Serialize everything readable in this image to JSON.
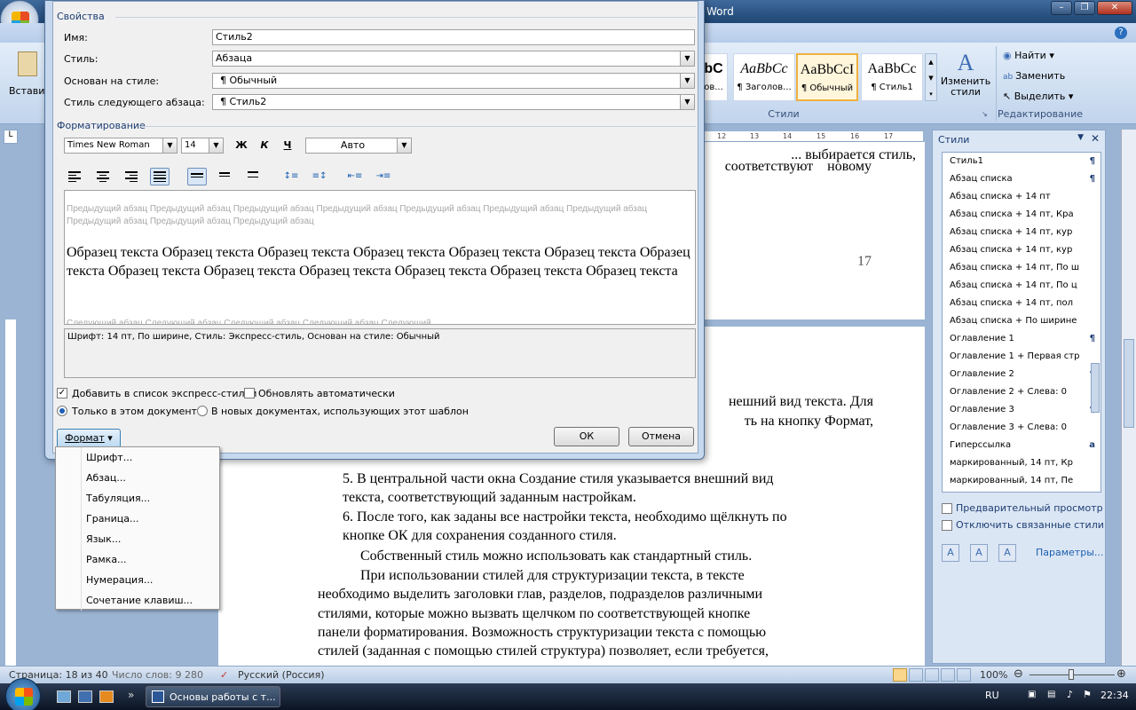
{
  "window": {
    "title": "Word"
  },
  "ribbon": {
    "paste_label": "Встави",
    "styles_group_label": "Стили",
    "editing_group_label": "Редактирование",
    "style_tiles": [
      {
        "sample": "bС",
        "name": "ов..."
      },
      {
        "sample": "AaBbCc",
        "name": "¶ Заголов..."
      },
      {
        "sample": "AaBbCcI",
        "name": "¶ Обычный"
      },
      {
        "sample": "AaBbCc",
        "name": "¶ Стиль1"
      }
    ],
    "change_styles_label": "Изменить стили",
    "find_label": "Найти",
    "replace_label": "Заменить",
    "select_label": "Выделить"
  },
  "ruler": {
    "marks": [
      "12",
      "13",
      "14",
      "15",
      "16",
      "17"
    ]
  },
  "document": {
    "page1_lines": [
      "... выбирается стиль,",
      "соответствуют новому"
    ],
    "page1_number": "17",
    "page2_lines_right": [
      "нешний вид текста. Для",
      "ть на кнопку Формат,"
    ],
    "page2_paragraphs": [
      "5. В центральной части окна Создание стиля указывается внешний вид",
      "текста, соответствующий заданным настройкам.",
      "6. После того, как заданы все настройки текста, необходимо щёлкнуть по",
      "кнопке ОК для сохранения созданного стиля.",
      "Собственный стиль можно использовать как стандартный стиль.",
      "При использовании стилей для структуризации текста, в тексте",
      "необходимо выделить заголовки глав, разделов, подразделов различными",
      "стилями, которые можно вызвать щелчком по соответствующей кнопке",
      "панели форматирования. Возможность структуризации текста с помощью",
      "стилей (заданная с помощью стилей структура) позволяет, если требуется,"
    ]
  },
  "styles_pane": {
    "title": "Стили",
    "items": [
      {
        "name": "Стиль1",
        "mark": "¶"
      },
      {
        "name": "Абзац списка",
        "mark": "¶"
      },
      {
        "name": "Абзац списка + 14 пт",
        "mark": ""
      },
      {
        "name": "Абзац списка + 14 пт, Кра",
        "mark": ""
      },
      {
        "name": "Абзац списка + 14 пт, кур",
        "mark": ""
      },
      {
        "name": "Абзац списка + 14 пт, кур",
        "mark": ""
      },
      {
        "name": "Абзац списка + 14 пт, По ш",
        "mark": ""
      },
      {
        "name": "Абзац списка + 14 пт, По ц",
        "mark": ""
      },
      {
        "name": "Абзац списка + 14 пт, пол",
        "mark": ""
      },
      {
        "name": "Абзац списка + По ширине",
        "mark": ""
      },
      {
        "name": "Оглавление 1",
        "mark": "¶"
      },
      {
        "name": "Оглавление 1 + Первая стр",
        "mark": ""
      },
      {
        "name": "Оглавление 2",
        "mark": "¶"
      },
      {
        "name": "Оглавление 2 + Слева:  0",
        "mark": ""
      },
      {
        "name": "Оглавление 3",
        "mark": "¶"
      },
      {
        "name": "Оглавление 3 + Слева:  0",
        "mark": ""
      },
      {
        "name": "Гиперссылка",
        "mark": "a"
      },
      {
        "name": "маркированный, 14 пт, Кр",
        "mark": ""
      },
      {
        "name": "маркированный, 14 пт, Пе",
        "mark": ""
      }
    ],
    "preview_label": "Предварительный просмотр",
    "disable_linked_label": "Отключить связанные стили",
    "params_label": "Параметры..."
  },
  "dialog": {
    "section_props": "Свойства",
    "name_label": "Имя:",
    "name_value": "Стиль2",
    "style_label": "Стиль:",
    "style_value": "Абзаца",
    "based_label": "Основан на стиле:",
    "based_value": "¶  Обычный",
    "next_label": "Стиль следующего абзаца:",
    "next_value": "¶  Стиль2",
    "section_format": "Форматирование",
    "font_name": "Times New Roman",
    "font_size": "14",
    "bold": "Ж",
    "italic": "К",
    "underline": "Ч",
    "color_value": "Авто",
    "preview_prev": "Предыдущий абзац Предыдущий абзац Предыдущий абзац Предыдущий абзац Предыдущий абзац Предыдущий абзац Предыдущий абзац Предыдущий абзац Предыдущий абзац Предыдущий абзац",
    "preview_sample": "Образец текста Образец текста Образец текста Образец текста Образец текста Образец текста Образец текста Образец текста Образец текста Образец текста Образец текста Образец текста Образец текста",
    "preview_next": "Следующий абзац Следующий абзац Следующий абзац Следующий абзац Следующий",
    "description": "Шрифт: 14 пт, По ширине, Стиль: Экспресс-стиль, Основан на стиле: Обычный",
    "add_quick_label": "Добавить в список экспресс-стилей",
    "auto_update_label": "Обновлять автоматически",
    "only_doc_label": "Только в этом документе",
    "new_docs_label": "В новых документах, использующих этот шаблон",
    "format_button": "Формат",
    "ok_button": "ОК",
    "cancel_button": "Отмена"
  },
  "format_menu": [
    "Шрифт...",
    "Абзац...",
    "Табуляция...",
    "Граница...",
    "Язык...",
    "Рамка...",
    "Нумерация...",
    "Сочетание клавиш..."
  ],
  "statusbar": {
    "page": "Страница: 18 из 40",
    "words": "Число слов: 9 280",
    "language": "Русский (Россия)",
    "zoom": "100%"
  },
  "taskbar": {
    "task_label": "Основы работы с т...",
    "lang": "RU",
    "time": "22:34"
  },
  "colors": {
    "accent": "#1b5fb8",
    "ribbon": "#cbdcf0",
    "titlebar": "#1f4673"
  }
}
